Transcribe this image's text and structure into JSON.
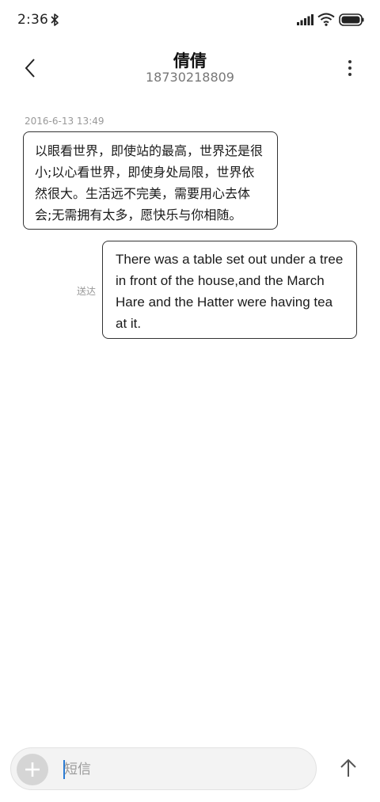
{
  "status_bar": {
    "time": "2:36",
    "icons": [
      "bluetooth-icon",
      "signal-icon",
      "wifi-icon",
      "battery-icon"
    ]
  },
  "header": {
    "contact_name": "倩倩",
    "contact_number": "18730218809",
    "back_icon": "chevron-left-icon",
    "more_icon": "more-vertical-icon"
  },
  "conversation": {
    "timestamp": "2016-6-13 13:49",
    "messages": [
      {
        "direction": "incoming",
        "lines": [
          "以眼看世界，即使站的最高，世界还是很",
          "小;以心看世界，即使身处局限，世界依",
          "然很大。生活远不完美，需要用心去体",
          "会;无需拥有太多，愿快乐与你相随。"
        ]
      },
      {
        "direction": "outgoing",
        "status": "送达",
        "lines": [
          "There was a table set out under a tree",
          "in front of the house,and the March",
          "Hare and the Hatter were having tea",
          "at it."
        ]
      }
    ]
  },
  "composer": {
    "placeholder": "短信",
    "value": "",
    "add_icon": "plus-icon",
    "send_icon": "arrow-up-icon"
  },
  "colors": {
    "bubble_border": "#333333",
    "composer_bg": "#f3f3f3",
    "add_button_bg": "#d5d5d5",
    "cursor": "#2a7bd4"
  }
}
